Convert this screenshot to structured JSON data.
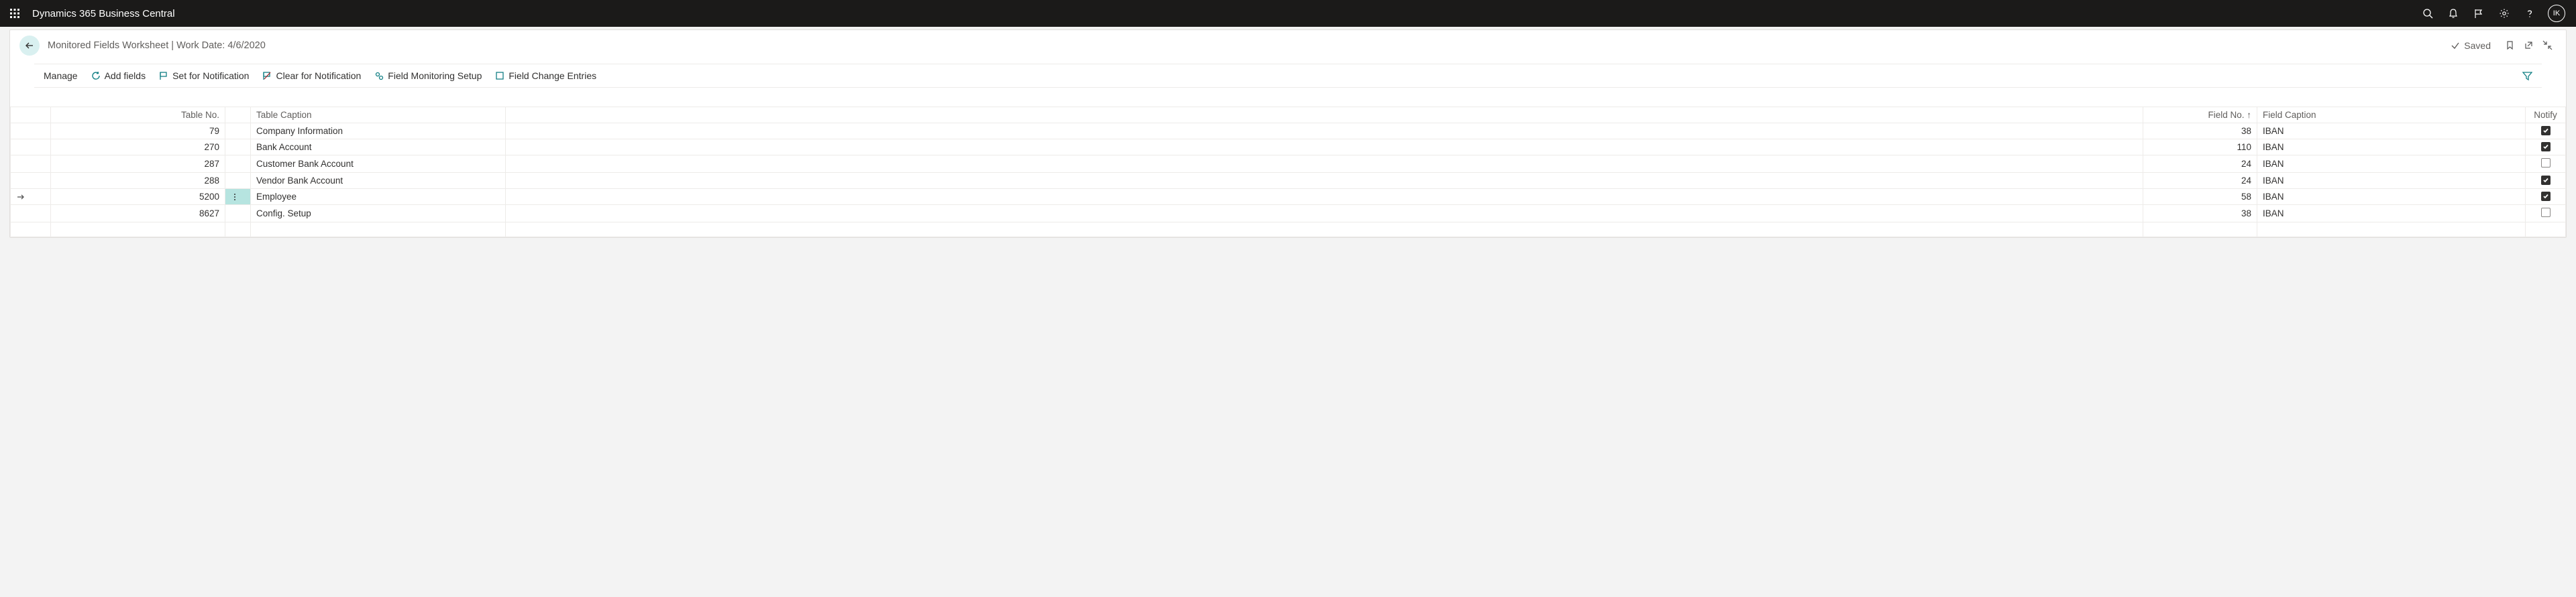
{
  "header": {
    "brand": "Dynamics 365 Business Central",
    "avatar_initials": "IK"
  },
  "titlebar": {
    "title": "Monitored Fields Worksheet | Work Date: 4/6/2020",
    "saved_label": "Saved"
  },
  "actions": {
    "manage": "Manage",
    "add_fields": "Add fields",
    "set_notification": "Set for Notification",
    "clear_notification": "Clear for Notification",
    "monitoring_setup": "Field Monitoring Setup",
    "change_entries": "Field Change Entries"
  },
  "columns": {
    "table_no": "Table No.",
    "table_caption": "Table Caption",
    "field_no": "Field No. ↑",
    "field_caption": "Field Caption",
    "notify": "Notify"
  },
  "rows": [
    {
      "selected": false,
      "table_no": "79",
      "caption": "Company Information",
      "field_no": "38",
      "field_caption": "IBAN",
      "notify": true
    },
    {
      "selected": false,
      "table_no": "270",
      "caption": "Bank Account",
      "field_no": "110",
      "field_caption": "IBAN",
      "notify": true
    },
    {
      "selected": false,
      "table_no": "287",
      "caption": "Customer Bank Account",
      "field_no": "24",
      "field_caption": "IBAN",
      "notify": false
    },
    {
      "selected": false,
      "table_no": "288",
      "caption": "Vendor Bank Account",
      "field_no": "24",
      "field_caption": "IBAN",
      "notify": true
    },
    {
      "selected": true,
      "table_no": "5200",
      "caption": "Employee",
      "field_no": "58",
      "field_caption": "IBAN",
      "notify": true
    },
    {
      "selected": false,
      "table_no": "8627",
      "caption": "Config. Setup",
      "field_no": "38",
      "field_caption": "IBAN",
      "notify": false
    }
  ]
}
